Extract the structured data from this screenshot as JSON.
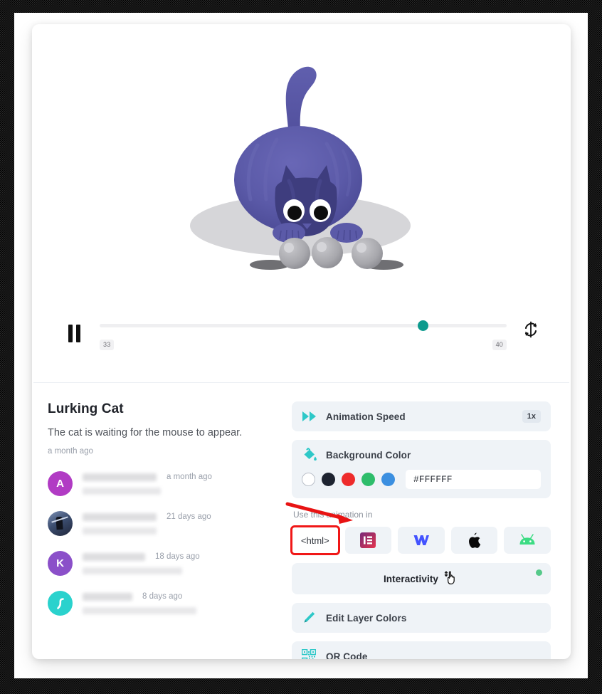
{
  "preview": {
    "illustration_name": "lurking-cat-animation",
    "cat_body_color": "#5b5aa8",
    "cat_head_color": "#3e3d7e",
    "ground_shadow_color": "#d4d4d7",
    "ball_color": "#a7a7ac"
  },
  "playback": {
    "pause_label": "Pause",
    "loop_label": "Loop",
    "frame_start": "33",
    "frame_end": "40",
    "progress_percent": 79.5,
    "thumb_color": "#0c9a8d",
    "track_color": "#efeff1"
  },
  "details": {
    "title": "Lurking Cat",
    "description": "The cat is waiting for the mouse to appear.",
    "date": "a month ago"
  },
  "comments": [
    {
      "avatar_letter": "A",
      "avatar_color": "#b13bc4",
      "avatar_type": "letter",
      "time": "a month ago",
      "name_redacted": true,
      "body_redacted": true
    },
    {
      "avatar_letter": "",
      "avatar_color": "#3c4e70",
      "avatar_type": "photo",
      "time": "21 days ago",
      "name_redacted": true,
      "body_redacted": true
    },
    {
      "avatar_letter": "K",
      "avatar_color": "#8b50c9",
      "avatar_type": "letter",
      "time": "18 days ago",
      "name_redacted": true,
      "body_redacted": true
    },
    {
      "avatar_letter": "",
      "avatar_color": "#2ad2cd",
      "avatar_type": "glyph",
      "time": "8 days ago",
      "name_redacted": true,
      "body_redacted": true
    }
  ],
  "controls": {
    "animation_speed": {
      "label": "Animation Speed",
      "value": "1x",
      "icon": "fast-forward-icon",
      "icon_color": "#2ec8c8"
    },
    "background_color": {
      "label": "Background Color",
      "icon": "paint-bucket-icon",
      "icon_color": "#2ec8c8",
      "hex_value": "#FFFFFF",
      "hex_placeholder": "#FFFFFF",
      "swatches": [
        {
          "name": "white",
          "color": "#ffffff",
          "selected": true
        },
        {
          "name": "black",
          "color": "#1d2330",
          "selected": false
        },
        {
          "name": "red",
          "color": "#ee2b2b",
          "selected": false
        },
        {
          "name": "green",
          "color": "#2ebd6b",
          "selected": false
        },
        {
          "name": "blue",
          "color": "#3b8fe0",
          "selected": false
        }
      ]
    },
    "use_in": {
      "label": "Use this animation in",
      "platforms": [
        {
          "name": "html",
          "label": "<html>",
          "icon": "html-tag-icon",
          "selected": true
        },
        {
          "name": "elementor",
          "label": "",
          "icon": "elementor-icon",
          "selected": false
        },
        {
          "name": "webflow",
          "label": "",
          "icon": "webflow-icon",
          "selected": false
        },
        {
          "name": "apple",
          "label": "",
          "icon": "apple-icon",
          "selected": false
        },
        {
          "name": "android",
          "label": "",
          "icon": "android-icon",
          "selected": false
        }
      ]
    },
    "interactivity": {
      "label": "Interactivity",
      "icon": "pointer-hand-icon",
      "status_dot_color": "#56c98a"
    },
    "edit_layer_colors": {
      "label": "Edit Layer Colors",
      "icon": "pencil-icon",
      "icon_color": "#2ec8c8"
    },
    "qr_code": {
      "label": "QR Code",
      "icon": "qr-code-icon",
      "icon_color": "#2ec8c8"
    }
  },
  "annotation": {
    "arrow_color": "#e81313",
    "highlight_color": "#f01717",
    "points_to": "html"
  }
}
